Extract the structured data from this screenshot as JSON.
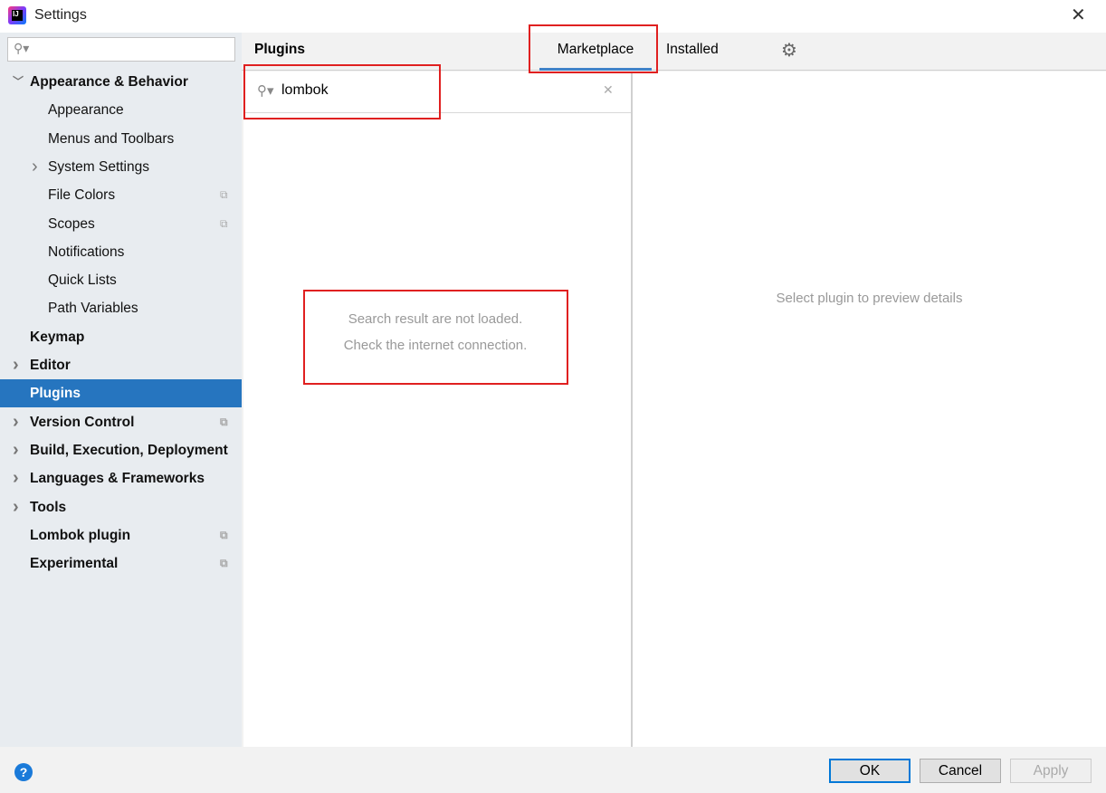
{
  "window": {
    "title": "Settings",
    "close": "✕"
  },
  "sidebar": {
    "search_placeholder": "",
    "items": [
      {
        "label": "Appearance & Behavior",
        "bold": true,
        "arrow": "﹀"
      },
      {
        "label": "Appearance"
      },
      {
        "label": "Menus and Toolbars"
      },
      {
        "label": "System Settings",
        "arrow": "›"
      },
      {
        "label": "File Colors",
        "copy": true
      },
      {
        "label": "Scopes",
        "copy": true
      },
      {
        "label": "Notifications"
      },
      {
        "label": "Quick Lists"
      },
      {
        "label": "Path Variables"
      },
      {
        "label": "Keymap",
        "bold": true
      },
      {
        "label": "Editor",
        "bold": true,
        "arrow": "›"
      },
      {
        "label": "Plugins",
        "bold": true,
        "selected": true
      },
      {
        "label": "Version Control",
        "bold": true,
        "arrow": "›",
        "copy": true
      },
      {
        "label": "Build, Execution, Deployment",
        "bold": true,
        "arrow": "›"
      },
      {
        "label": "Languages & Frameworks",
        "bold": true,
        "arrow": "›"
      },
      {
        "label": "Tools",
        "bold": true,
        "arrow": "›"
      },
      {
        "label": "Lombok plugin",
        "bold": true,
        "copy": true
      },
      {
        "label": "Experimental",
        "bold": true,
        "copy": true
      }
    ]
  },
  "header": {
    "title": "Plugins",
    "tabs": [
      {
        "label": "Marketplace",
        "active": true
      },
      {
        "label": "Installed"
      }
    ]
  },
  "plugin_search": {
    "value": "lombok"
  },
  "list": {
    "message_line1": "Search result are not loaded.",
    "message_line2": "Check the internet connection."
  },
  "detail": {
    "message": "Select plugin to preview details"
  },
  "footer": {
    "help": "?",
    "ok": "OK",
    "cancel": "Cancel",
    "apply": "Apply"
  },
  "colors": {
    "selection": "#2675bf",
    "annotation": "#e02020",
    "tab_underline": "#4083c9"
  }
}
